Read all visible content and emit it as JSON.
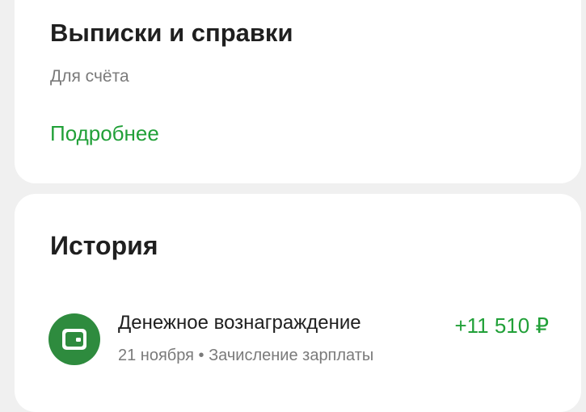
{
  "statements": {
    "title": "Выписки и справки",
    "subtitle": "Для счёта",
    "more_link": "Подробнее"
  },
  "history": {
    "title": "История",
    "transactions": [
      {
        "name": "Денежное вознаграждение",
        "amount": "+11 510 ₽",
        "meta": "21 ноября • Зачисление зарплаты",
        "icon": "wallet-icon"
      }
    ]
  },
  "colors": {
    "accent_green": "#21a038",
    "icon_bg": "#2e8b3e",
    "page_bg": "#f0f0f0",
    "card_bg": "#ffffff",
    "secondary_text": "#7a7a7a"
  }
}
